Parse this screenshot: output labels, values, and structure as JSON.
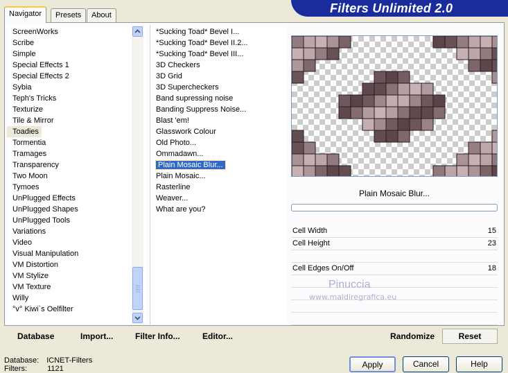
{
  "tabs": [
    "Navigator",
    "Presets",
    "About"
  ],
  "banner_title": "Filters Unlimited 2.0",
  "categories": [
    "ScreenWorks",
    "Scribe",
    "Simple",
    "Special Effects 1",
    "Special Effects 2",
    "Sybia",
    "Teph's Tricks",
    "Texturize",
    "Tile & Mirror",
    "Toadies",
    "Tormentia",
    "Tramages",
    "Transparency",
    "Two Moon",
    "Tymoes",
    "UnPlugged Effects",
    "UnPlugged Shapes",
    "UnPlugged Tools",
    "Variations",
    "Video",
    "Visual Manipulation",
    "VM Distortion",
    "VM Stylize",
    "VM Texture",
    "Willy",
    "°v° Kiwi`s Oelfilter"
  ],
  "selected_category": "Toadies",
  "filters": [
    "*Sucking Toad* Bevel I...",
    "*Sucking Toad* Bevel II.2...",
    "*Sucking Toad* Bevel III...",
    "3D Checkers",
    "3D Grid",
    "3D Supercheckers",
    "Band supressing noise",
    "Banding Suppress Noise...",
    "Blast 'em!",
    "Glasswork Colour",
    "Old Photo...",
    "Ommadawn...",
    "Plain Mosaic Blur...",
    "Plain Mosaic...",
    "Rasterline",
    "Weaver...",
    "What are you?"
  ],
  "selected_filter": "Plain Mosaic Blur...",
  "filter_name_display": "Plain Mosaic Blur...",
  "params": [
    {
      "label": "Cell Width",
      "value": "15"
    },
    {
      "label": "Cell Height",
      "value": "23"
    },
    {
      "label": "Cell Edges On/Off",
      "value": "18"
    }
  ],
  "watermark": {
    "name": "Pinuccia",
    "url": "www.maidiregrafica.eu"
  },
  "toolbar": {
    "database": "Database",
    "import": "Import...",
    "filter_info": "Filter Info...",
    "editor": "Editor...",
    "randomize": "Randomize",
    "reset": "Reset"
  },
  "status": {
    "database_label": "Database:",
    "database_value": "ICNET-Filters",
    "filters_label": "Filters:",
    "filters_value": "1121"
  },
  "buttons": {
    "apply": "Apply",
    "cancel": "Cancel",
    "help": "Help"
  },
  "colors": {
    "banner": "#1a2c9c",
    "selection": "#316ac5",
    "mosaic_dark": "#5a4448",
    "mosaic_light": "#c8b8bc"
  }
}
